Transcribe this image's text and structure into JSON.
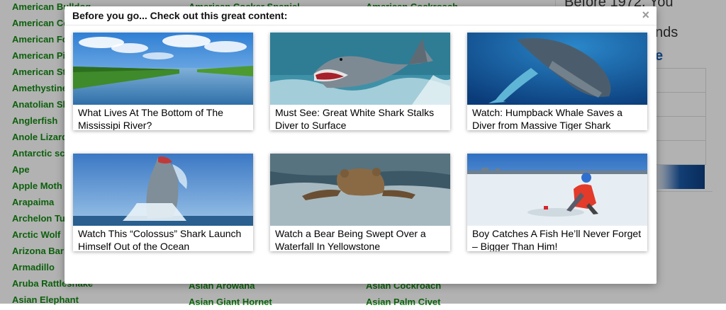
{
  "background": {
    "columns": [
      [
        "American Bulldog",
        "American Cocker Spaniel (partial)",
        "American Foxhound",
        "American Pit Bull",
        "American Staffordshire",
        "Amethystine Python",
        "Anatolian Shepherd",
        "Anglerfish",
        "Anole Lizard",
        "Antarctic scale worm",
        "Ape",
        "Apple Moth",
        "Arapaima",
        "Archelon Turtle",
        "Arctic Wolf",
        "Arizona Bark Scorpion",
        "Armadillo",
        "Aruba Rattlesnake",
        "Asian Elephant"
      ],
      [
        "American Cocker Spaniel",
        "",
        "",
        "",
        "",
        "",
        "",
        "",
        "",
        "",
        "",
        "",
        "",
        "",
        "",
        "",
        "",
        "Asian Arowana",
        "Asian Giant Hornet"
      ],
      [
        "American Cockroach",
        "",
        "",
        "",
        "",
        "",
        "",
        "",
        "",
        "",
        "",
        "",
        "",
        "",
        "",
        "",
        "",
        "Asian Cockroach",
        "Asian Palm Civet"
      ]
    ],
    "col1_display": [
      "American Bulldog",
      "American Co",
      "American Fo",
      "American Pi",
      "American St",
      "Amethystine",
      "Anatolian Sh",
      "Anglerfish",
      "Anole Lizard",
      "Antarctic sca",
      "Ape",
      "Apple Moth",
      "Arapaima",
      "Archelon Tu",
      "Arctic Wolf",
      "Arizona Bark",
      "Armadillo",
      "Aruba Rattlesnake",
      "Asian Elephant"
    ],
    "col2_display": [
      "American Cocker Spaniel",
      "Asian Arowana",
      "Asian Giant Hornet"
    ],
    "col3_display": [
      "American Cockroach",
      "Asian Cockroach",
      "Asian Palm Civet"
    ],
    "link_color": "#138a13",
    "right_panel": {
      "line1": "Before 1972. You",
      "line2": "nds",
      "link": "e"
    }
  },
  "modal": {
    "title": "Before you go... Check out this great content:",
    "close_label": "×",
    "cards": [
      {
        "caption": "What Lives At The Bottom of The Mississipi River?",
        "image": "river-landscape"
      },
      {
        "caption": "Must See: Great White Shark Stalks Diver to Surface",
        "image": "great-white-shark"
      },
      {
        "caption": "Watch: Humpback Whale Saves a Diver from Massive Tiger Shark",
        "image": "humpback-whale"
      },
      {
        "caption": "Watch This “Colossus” Shark Launch Himself Out of the Ocean",
        "image": "breaching-shark"
      },
      {
        "caption": "Watch a Bear Being Swept Over a Waterfall In Yellowstone",
        "image": "bear-in-water"
      },
      {
        "caption": "Boy Catches A Fish He’ll Never Forget – Bigger Than Him!",
        "image": "ice-fishing"
      }
    ]
  }
}
